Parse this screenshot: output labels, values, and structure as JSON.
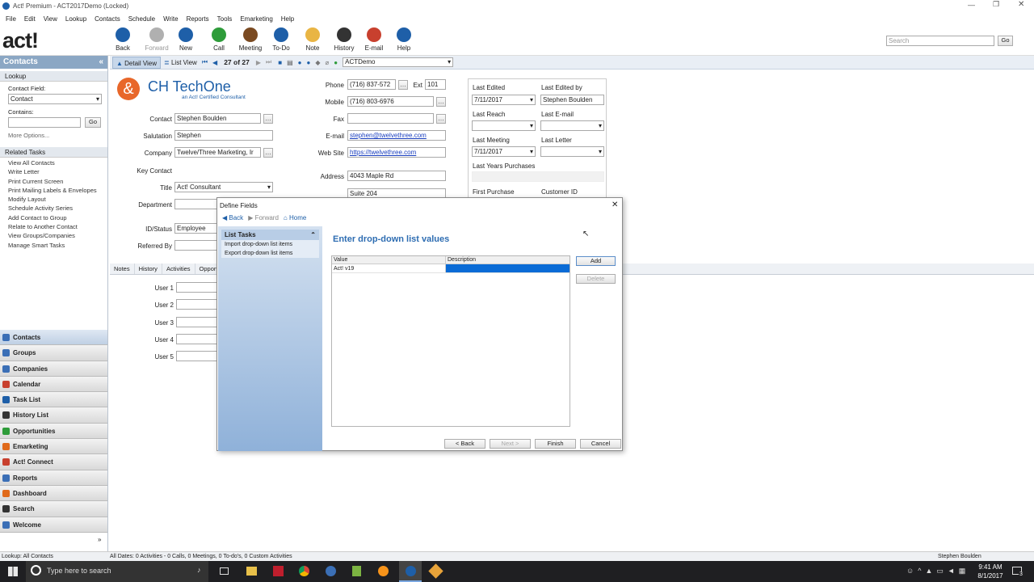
{
  "window": {
    "title": "Act! Premium - ACT2017Demo (Locked)"
  },
  "menu": [
    "File",
    "Edit",
    "View",
    "Lookup",
    "Contacts",
    "Schedule",
    "Write",
    "Reports",
    "Tools",
    "Emarketing",
    "Help"
  ],
  "toolbar": {
    "items": [
      {
        "label": "Back",
        "icon": "back-icon",
        "color": "#1e5fa8"
      },
      {
        "label": "Forward",
        "icon": "forward-icon",
        "color": "#b0b0b0"
      },
      {
        "label": "New",
        "icon": "new-contact-icon",
        "color": "#1e5fa8"
      },
      {
        "label": "Call",
        "icon": "phone-icon",
        "color": "#2e9c3a"
      },
      {
        "label": "Meeting",
        "icon": "meeting-icon",
        "color": "#7a4a21"
      },
      {
        "label": "To-Do",
        "icon": "todo-icon",
        "color": "#1e5fa8"
      },
      {
        "label": "Note",
        "icon": "note-icon",
        "color": "#e9b544"
      },
      {
        "label": "History",
        "icon": "history-icon",
        "color": "#333333"
      },
      {
        "label": "E-mail",
        "icon": "email-icon",
        "color": "#c8402e"
      },
      {
        "label": "Help",
        "icon": "help-icon",
        "color": "#1e5fa8"
      }
    ],
    "search_placeholder": "Search",
    "go": "Go"
  },
  "viewbar": {
    "detail": "Detail View",
    "list": "List View",
    "record": "27 of 27",
    "db": "ACTDemo"
  },
  "left": {
    "title": "Contacts",
    "lookup": "Lookup",
    "contact_field_label": "Contact Field:",
    "contact_field_value": "Contact",
    "contains_label": "Contains:",
    "go": "Go",
    "more": "More Options...",
    "related_title": "Related Tasks",
    "tasks": [
      "View All Contacts",
      "Write Letter",
      "Print Current Screen",
      "Print Mailing Labels & Envelopes",
      "Modify Layout",
      "Schedule Activity Series",
      "Add Contact to Group",
      "Relate to Another Contact",
      "View Groups/Companies",
      "Manage Smart Tasks"
    ],
    "nav": [
      {
        "label": "Contacts",
        "color": "#3b6fb6"
      },
      {
        "label": "Groups",
        "color": "#3b6fb6"
      },
      {
        "label": "Companies",
        "color": "#3b6fb6"
      },
      {
        "label": "Calendar",
        "color": "#c8402e"
      },
      {
        "label": "Task List",
        "color": "#1e5fa8"
      },
      {
        "label": "History List",
        "color": "#333333"
      },
      {
        "label": "Opportunities",
        "color": "#2e9c3a"
      },
      {
        "label": "Emarketing",
        "color": "#e06a1b"
      },
      {
        "label": "Act! Connect",
        "color": "#c8402e"
      },
      {
        "label": "Reports",
        "color": "#3b6fb6"
      },
      {
        "label": "Dashboard",
        "color": "#e06a1b"
      },
      {
        "label": "Search",
        "color": "#333333"
      },
      {
        "label": "Welcome",
        "color": "#3b6fb6"
      }
    ]
  },
  "company_logo": {
    "name": "CH TechOne",
    "tagline": "an Act! Certified Consultant"
  },
  "contact": {
    "contact_label": "Contact",
    "contact": "Stephen Boulden",
    "salutation_label": "Salutation",
    "salutation": "Stephen",
    "company_label": "Company",
    "company": "Twelve/Three Marketing, Ir",
    "key_label": "Key Contact",
    "title_label": "Title",
    "title": "Act! Consultant",
    "department_label": "Department",
    "id_label": "ID/Status",
    "id_status": "Employee",
    "referred_label": "Referred By",
    "phone_label": "Phone",
    "phone": "(716) 837-572",
    "ext_label": "Ext",
    "ext": "101",
    "mobile_label": "Mobile",
    "mobile": "(716) 803-6976",
    "fax_label": "Fax",
    "email_label": "E-mail",
    "email": "stephen@twelvethree.com",
    "web_label": "Web Site",
    "web": "https://twelvethree.com",
    "address_label": "Address",
    "address1": "4043 Maple Rd",
    "address2": "Suite 204"
  },
  "history": {
    "last_edited_label": "Last Edited",
    "last_edited": "7/11/2017",
    "last_edited_by_label": "Last Edited by",
    "last_edited_by": "Stephen Boulden",
    "last_reach_label": "Last Reach",
    "last_email_label": "Last E-mail",
    "last_meeting_label": "Last Meeting",
    "last_meeting": "7/11/2017",
    "last_letter_label": "Last Letter",
    "last_years_label": "Last Years Purchases",
    "first_purchase_label": "First Purchase",
    "customer_id_label": "Customer ID"
  },
  "tabs": [
    "Notes",
    "History",
    "Activities",
    "Opportun"
  ],
  "user_fields": [
    "User 1",
    "User 2",
    "User 3",
    "User 4",
    "User 5"
  ],
  "dialog": {
    "title": "Define Fields",
    "back": "Back",
    "forward": "Forward",
    "home": "Home",
    "list_tasks": "List Tasks",
    "tasks": [
      "Import drop-down list items",
      "Export drop-down list items"
    ],
    "heading": "Enter drop-down list values",
    "columns": [
      "Value",
      "Description"
    ],
    "rows": [
      {
        "value": "Act! v19",
        "description": ""
      }
    ],
    "add": "Add",
    "delete": "Delete",
    "back_btn": "< Back",
    "next_btn": "Next >",
    "finish": "Finish",
    "cancel": "Cancel"
  },
  "status": {
    "lookup": "Lookup: All Contacts",
    "activities": "All Dates: 0 Activities - 0 Calls, 0 Meetings, 0 To-do's, 0 Custom Activities",
    "user": "Stephen Boulden"
  },
  "taskbar": {
    "search": "Type here to search",
    "time": "9:41 AM",
    "date": "8/1/2017",
    "notif": "3"
  }
}
